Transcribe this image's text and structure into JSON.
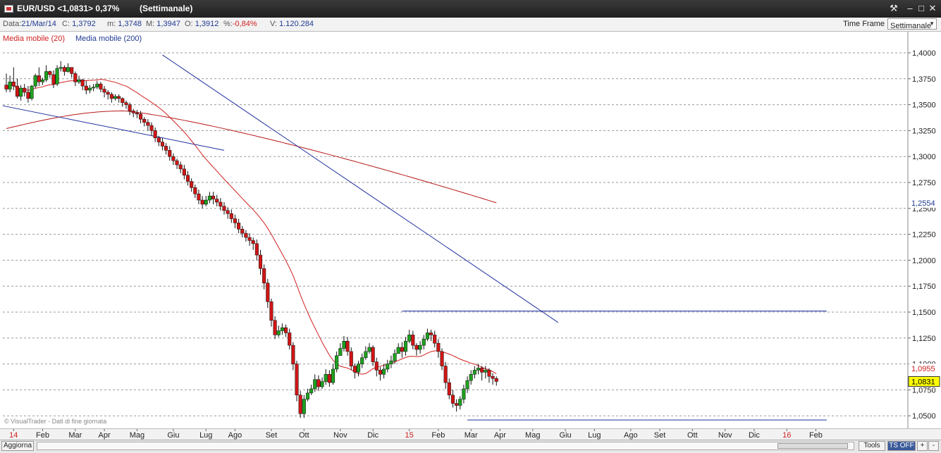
{
  "window": {
    "title": "EUR/USD <1,0831> 0,37%",
    "period": "(Settimanale)",
    "controls": [
      "tool-icon",
      "minimize-icon",
      "maximize-icon",
      "close-icon"
    ]
  },
  "infobar": {
    "data_label": "Data:",
    "data_value": "21/Mar/14",
    "c_label": "C:",
    "c_value": "1,3792",
    "m_label": "m:",
    "m_value": "1,3748",
    "M_label": "M:",
    "M_value": "1,3947",
    "o_label": "O:",
    "o_value": "1,3912",
    "pct_label": "%:",
    "pct_value": "-0,84%",
    "v_label": "V:",
    "v_value": "1.120.284",
    "timeframe_label": "Time Frame",
    "timeframe_value": "Settimanale"
  },
  "legend": {
    "ma20": "Media mobile (20)",
    "ma200": "Media mobile (200)"
  },
  "watermark": "© VisualTrader - Dati di fine giornata",
  "statusbar": {
    "refresh": "Aggiorna",
    "tools": "Tools",
    "ts": "TS OFF"
  },
  "colors": {
    "up": "#1fa01f",
    "down": "#d01515",
    "ma20": "#d02020",
    "ma200": "#b81818",
    "trendline": "#1f2f9f",
    "highlight_label": "#ffff00"
  },
  "chart_data": {
    "type": "candlestick",
    "ylim": [
      1.035,
      1.41
    ],
    "yticks": [
      "1,4000",
      "1,3750",
      "1,3500",
      "1,3250",
      "1,3000",
      "1,2750",
      "1,2500",
      "1,2250",
      "1,2000",
      "1,1750",
      "1,1500",
      "1,1250",
      "1,1000",
      "1,0750",
      "1,0500"
    ],
    "ytick_values": [
      1.4,
      1.375,
      1.35,
      1.325,
      1.3,
      1.275,
      1.25,
      1.225,
      1.2,
      1.175,
      1.15,
      1.125,
      1.1,
      1.075,
      1.05
    ],
    "xticks": [
      "14",
      "Feb",
      "Mar",
      "Apr",
      "Mag",
      "Giu",
      "Lug",
      "Ago",
      "Set",
      "Ott",
      "Nov",
      "Dic",
      "15",
      "Feb",
      "Mar",
      "Apr",
      "Mag",
      "Giu",
      "Lug",
      "Ago",
      "Set",
      "Ott",
      "Nov",
      "Dic",
      "16",
      "Feb"
    ],
    "xtick_index": [
      2,
      10,
      19,
      27,
      36,
      46,
      55,
      63,
      73,
      82,
      92,
      101,
      111,
      119,
      128,
      136,
      145,
      154,
      162,
      172,
      180,
      189,
      198,
      206,
      215,
      223
    ],
    "xtick_red": [
      "14",
      "15",
      "16"
    ],
    "price_labels": [
      {
        "text": "1,2554",
        "value": 1.2554,
        "kind": "ma200"
      },
      {
        "text": "1,0955",
        "value": 1.0955,
        "kind": "ma20"
      },
      {
        "text": "1,0831",
        "value": 1.0831,
        "kind": "last"
      }
    ],
    "close_start": 1.369,
    "close": [
      1.365,
      1.372,
      1.368,
      1.358,
      1.366,
      1.362,
      1.356,
      1.368,
      1.378,
      1.372,
      1.374,
      1.382,
      1.379,
      1.37,
      1.385,
      1.386,
      1.382,
      1.386,
      1.38,
      1.372,
      1.374,
      1.368,
      1.364,
      1.366,
      1.367,
      1.37,
      1.365,
      1.362,
      1.36,
      1.356,
      1.358,
      1.356,
      1.352,
      1.35,
      1.344,
      1.342,
      1.341,
      1.336,
      1.333,
      1.33,
      1.325,
      1.318,
      1.314,
      1.31,
      1.306,
      1.3,
      1.296,
      1.292,
      1.288,
      1.282,
      1.276,
      1.27,
      1.264,
      1.258,
      1.254,
      1.258,
      1.262,
      1.259,
      1.256,
      1.252,
      1.248,
      1.245,
      1.24,
      1.236,
      1.23,
      1.226,
      1.222,
      1.219,
      1.216,
      1.205,
      1.192,
      1.178,
      1.16,
      1.142,
      1.128,
      1.132,
      1.135,
      1.13,
      1.118,
      1.1,
      1.07,
      1.052,
      1.066,
      1.072,
      1.076,
      1.085,
      1.078,
      1.083,
      1.09,
      1.082,
      1.095,
      1.108,
      1.115,
      1.122,
      1.112,
      1.098,
      1.092,
      1.1,
      1.106,
      1.112,
      1.116,
      1.102,
      1.094,
      1.09,
      1.095,
      1.1,
      1.103,
      1.11,
      1.116,
      1.112,
      1.122,
      1.128,
      1.118,
      1.114,
      1.118,
      1.124,
      1.13,
      1.128,
      1.12,
      1.112,
      1.098,
      1.082,
      1.07,
      1.062,
      1.06,
      1.066,
      1.076,
      1.084,
      1.09,
      1.094,
      1.096,
      1.092,
      1.094,
      1.088,
      1.086,
      1.0831
    ],
    "high": [
      1.38,
      1.378,
      1.386,
      1.375,
      1.369,
      1.37,
      1.368,
      1.369,
      1.38,
      1.386,
      1.376,
      1.388,
      1.383,
      1.383,
      1.388,
      1.392,
      1.388,
      1.39,
      1.386,
      1.382,
      1.378,
      1.375,
      1.373,
      1.369,
      1.37,
      1.373,
      1.372,
      1.368,
      1.364,
      1.362,
      1.36,
      1.36,
      1.357,
      1.354,
      1.352,
      1.346,
      1.345,
      1.344,
      1.338,
      1.336,
      1.333,
      1.328,
      1.32,
      1.318,
      1.313,
      1.31,
      1.303,
      1.298,
      1.295,
      1.292,
      1.286,
      1.279,
      1.273,
      1.268,
      1.262,
      1.262,
      1.266,
      1.266,
      1.263,
      1.26,
      1.256,
      1.251,
      1.249,
      1.244,
      1.24,
      1.233,
      1.229,
      1.226,
      1.222,
      1.22,
      1.21,
      1.196,
      1.182,
      1.163,
      1.146,
      1.137,
      1.139,
      1.138,
      1.134,
      1.121,
      1.103,
      1.074,
      1.07,
      1.076,
      1.08,
      1.09,
      1.089,
      1.087,
      1.095,
      1.094,
      1.1,
      1.112,
      1.12,
      1.127,
      1.126,
      1.116,
      1.1,
      1.103,
      1.11,
      1.117,
      1.12,
      1.118,
      1.106,
      1.097,
      1.1,
      1.104,
      1.108,
      1.114,
      1.12,
      1.121,
      1.126,
      1.133,
      1.132,
      1.12,
      1.122,
      1.128,
      1.134,
      1.133,
      1.132,
      1.124,
      1.115,
      1.102,
      1.086,
      1.075,
      1.066,
      1.069,
      1.08,
      1.088,
      1.094,
      1.098,
      1.1,
      1.098,
      1.098,
      1.096,
      1.091,
      1.088
    ],
    "low": [
      1.362,
      1.362,
      1.364,
      1.356,
      1.354,
      1.358,
      1.352,
      1.354,
      1.366,
      1.368,
      1.369,
      1.372,
      1.376,
      1.366,
      1.368,
      1.382,
      1.378,
      1.381,
      1.376,
      1.368,
      1.37,
      1.364,
      1.36,
      1.361,
      1.363,
      1.365,
      1.362,
      1.357,
      1.355,
      1.352,
      1.354,
      1.352,
      1.348,
      1.346,
      1.34,
      1.338,
      1.337,
      1.332,
      1.329,
      1.325,
      1.32,
      1.314,
      1.31,
      1.306,
      1.302,
      1.296,
      1.292,
      1.288,
      1.284,
      1.278,
      1.272,
      1.266,
      1.26,
      1.254,
      1.25,
      1.252,
      1.255,
      1.254,
      1.252,
      1.248,
      1.244,
      1.24,
      1.236,
      1.231,
      1.226,
      1.222,
      1.218,
      1.214,
      1.21,
      1.2,
      1.186,
      1.172,
      1.154,
      1.136,
      1.124,
      1.126,
      1.128,
      1.126,
      1.114,
      1.094,
      1.064,
      1.048,
      1.048,
      1.064,
      1.07,
      1.073,
      1.074,
      1.076,
      1.08,
      1.078,
      1.08,
      1.092,
      1.108,
      1.112,
      1.108,
      1.094,
      1.086,
      1.088,
      1.096,
      1.104,
      1.11,
      1.098,
      1.088,
      1.084,
      1.086,
      1.092,
      1.096,
      1.1,
      1.11,
      1.106,
      1.108,
      1.12,
      1.114,
      1.108,
      1.11,
      1.114,
      1.122,
      1.122,
      1.116,
      1.106,
      1.094,
      1.076,
      1.066,
      1.058,
      1.054,
      1.056,
      1.062,
      1.072,
      1.08,
      1.086,
      1.09,
      1.084,
      1.086,
      1.082,
      1.08,
      1.079
    ]
  }
}
